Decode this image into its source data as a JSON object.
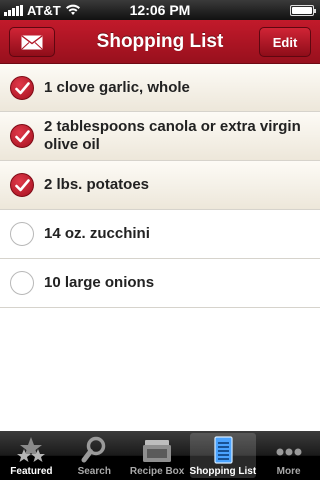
{
  "status_bar": {
    "carrier": "AT&T",
    "time": "12:06 PM",
    "battery_level": 1.0
  },
  "nav_bar": {
    "title": "Shopping List",
    "edit_label": "Edit",
    "left_icon": "envelope-icon"
  },
  "items": [
    {
      "text": "1 clove garlic, whole",
      "checked": true
    },
    {
      "text": "2 tablespoons canola or extra virgin olive oil",
      "checked": true
    },
    {
      "text": "2 lbs. potatoes",
      "checked": true
    },
    {
      "text": "14 oz. zucchini",
      "checked": false
    },
    {
      "text": "10 large onions",
      "checked": false
    }
  ],
  "tabs": [
    {
      "label": "Featured",
      "icon": "stars-icon",
      "active": false
    },
    {
      "label": "Search",
      "icon": "magnifier-icon",
      "active": false
    },
    {
      "label": "Recipe Box",
      "icon": "recipe-box-icon",
      "active": false
    },
    {
      "label": "Shopping List",
      "icon": "notepad-icon",
      "active": true
    },
    {
      "label": "More",
      "icon": "more-dots-icon",
      "active": false
    }
  ],
  "colors": {
    "brand_red": "#b01424",
    "tab_bar": "#000000"
  }
}
